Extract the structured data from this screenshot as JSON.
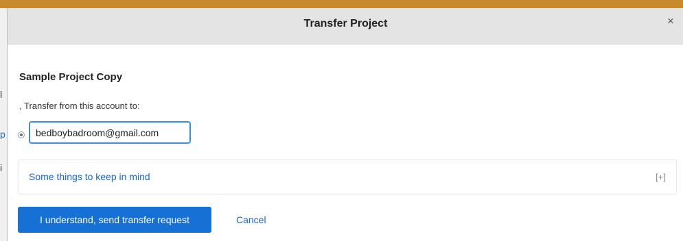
{
  "modal": {
    "title": "Transfer Project",
    "close_label": "×",
    "project_name": "Sample Project Copy",
    "transfer_label": ", Transfer from this account to:",
    "recipient": {
      "selected": true,
      "email_value": "bedboybadroom@gmail.com"
    },
    "info_box": {
      "link_label": "Some things to keep in mind",
      "toggle_label": "[+]"
    },
    "buttons": {
      "confirm_label": "I understand, send transfer request",
      "cancel_label": "Cancel"
    }
  },
  "background": {
    "fragments": [
      "l",
      "p",
      "i"
    ]
  },
  "colors": {
    "accent": "#1771d4",
    "link": "#1a66c9",
    "header_bg": "#e4e4e4",
    "input_border": "#3b8fe0",
    "top_strip": "#c98a2e"
  },
  "icons": {
    "close": "close-icon",
    "radio": "radio-selected-icon"
  }
}
